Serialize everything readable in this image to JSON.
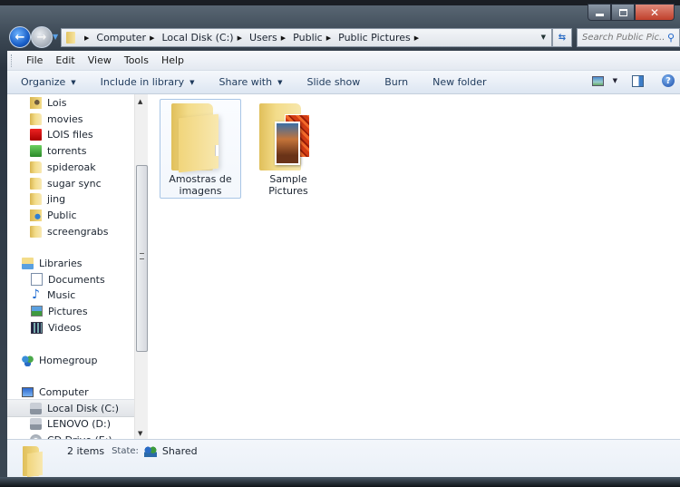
{
  "window": {
    "controls": {
      "minimize": "minimize",
      "maximize": "maximize",
      "close": "close"
    }
  },
  "navigation": {
    "back_icon": "back-arrow-icon",
    "forward_icon": "forward-arrow-icon",
    "breadcrumb": [
      "Computer",
      "Local Disk (C:)",
      "Users",
      "Public",
      "Public Pictures"
    ],
    "search_placeholder": "Search Public Pic...",
    "search_icon": "magnifier-icon"
  },
  "menubar": [
    "File",
    "Edit",
    "View",
    "Tools",
    "Help"
  ],
  "commandbar": {
    "items": [
      {
        "label": "Organize",
        "dropdown": true
      },
      {
        "label": "Include in library",
        "dropdown": true
      },
      {
        "label": "Share with",
        "dropdown": true
      },
      {
        "label": "Slide show",
        "dropdown": false
      },
      {
        "label": "Burn",
        "dropdown": false
      },
      {
        "label": "New folder",
        "dropdown": false
      }
    ],
    "right_icons": [
      "change-view-icon",
      "preview-pane-icon",
      "help-icon"
    ]
  },
  "sidebar": {
    "items": [
      {
        "label": "Lois",
        "icon": "user-folder-icon",
        "level": 1
      },
      {
        "label": "movies",
        "icon": "folder-icon",
        "level": 1
      },
      {
        "label": "LOIS files",
        "icon": "red-folder-icon",
        "level": 1
      },
      {
        "label": "torrents",
        "icon": "green-folder-icon",
        "level": 1
      },
      {
        "label": "spideroak",
        "icon": "folder-icon",
        "level": 1
      },
      {
        "label": "sugar sync",
        "icon": "folder-icon",
        "level": 1
      },
      {
        "label": "jing",
        "icon": "folder-icon",
        "level": 1
      },
      {
        "label": "Public",
        "icon": "public-folder-icon",
        "level": 1
      },
      {
        "label": "screengrabs",
        "icon": "folder-icon",
        "level": 1
      },
      {
        "label": "Libraries",
        "icon": "libraries-icon",
        "level": 0
      },
      {
        "label": "Documents",
        "icon": "documents-icon",
        "level": 1
      },
      {
        "label": "Music",
        "icon": "music-icon",
        "level": 1
      },
      {
        "label": "Pictures",
        "icon": "pictures-icon",
        "level": 1
      },
      {
        "label": "Videos",
        "icon": "videos-icon",
        "level": 1
      },
      {
        "label": "Homegroup",
        "icon": "homegroup-icon",
        "level": 0
      },
      {
        "label": "Computer",
        "icon": "computer-icon",
        "level": 0
      },
      {
        "label": "Local Disk (C:)",
        "icon": "local-disk-icon",
        "level": 1,
        "selected": true
      },
      {
        "label": "LENOVO (D:)",
        "icon": "drive-icon",
        "level": 1
      },
      {
        "label": "CD Drive (E:)",
        "icon": "cd-drive-icon",
        "level": 1
      }
    ]
  },
  "content": {
    "items": [
      {
        "label_line1": "Amostras de",
        "label_line2": "imagens",
        "icon": "folder-icon",
        "selected": true
      },
      {
        "label_line1": "Sample Pictures",
        "label_line2": "",
        "icon": "pictures-folder-icon",
        "selected": false
      }
    ]
  },
  "status": {
    "count": "2 items",
    "state_label": "State:",
    "state_icon": "shared-users-icon",
    "state_value": "Shared"
  }
}
